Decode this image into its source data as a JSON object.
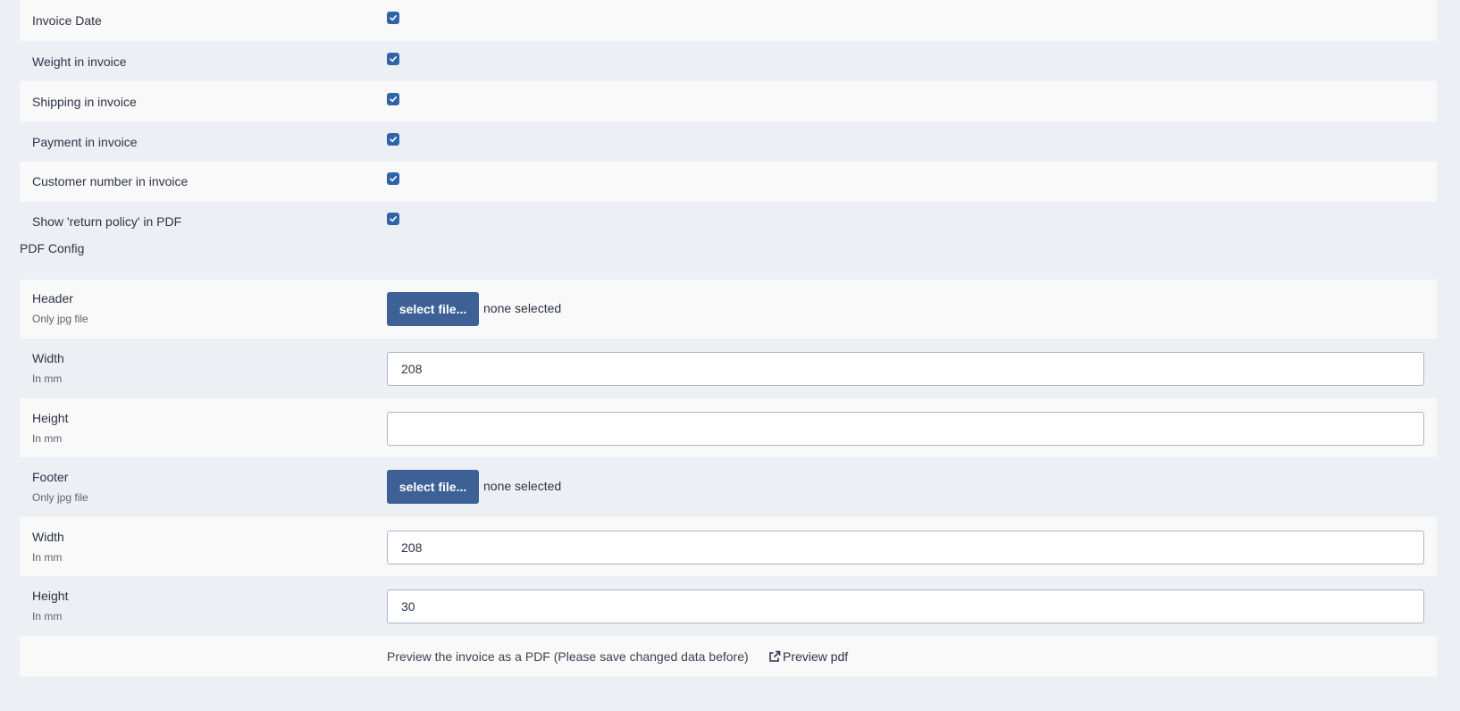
{
  "invoice_options": [
    {
      "label": "Invoice Date",
      "checked": true
    },
    {
      "label": "Weight in invoice",
      "checked": true
    },
    {
      "label": "Shipping in invoice",
      "checked": true
    },
    {
      "label": "Payment in invoice",
      "checked": true
    },
    {
      "label": "Customer number in invoice",
      "checked": true
    },
    {
      "label": "Show 'return policy' in PDF",
      "checked": true
    }
  ],
  "pdf_config": {
    "title": "PDF Config",
    "header": {
      "label": "Header",
      "hint": "Only jpg file",
      "button": "select file...",
      "status": "none selected"
    },
    "header_width": {
      "label": "Width",
      "hint": "In mm",
      "value": "208"
    },
    "header_height": {
      "label": "Height",
      "hint": "In mm",
      "value": ""
    },
    "footer": {
      "label": "Footer",
      "hint": "Only jpg file",
      "button": "select file...",
      "status": "none selected"
    },
    "footer_width": {
      "label": "Width",
      "hint": "In mm",
      "value": "208"
    },
    "footer_height": {
      "label": "Height",
      "hint": "In mm",
      "value": "30"
    },
    "preview_text": "Preview the invoice as a PDF (Please save changed data before)",
    "preview_link": "Preview pdf",
    "preview_icon": "external-link-icon"
  },
  "colors": {
    "checkbox": "#2f64a8",
    "button": "#3d6196",
    "row_light": "#f9f9f9",
    "row_dark": "#ecf0f5"
  }
}
